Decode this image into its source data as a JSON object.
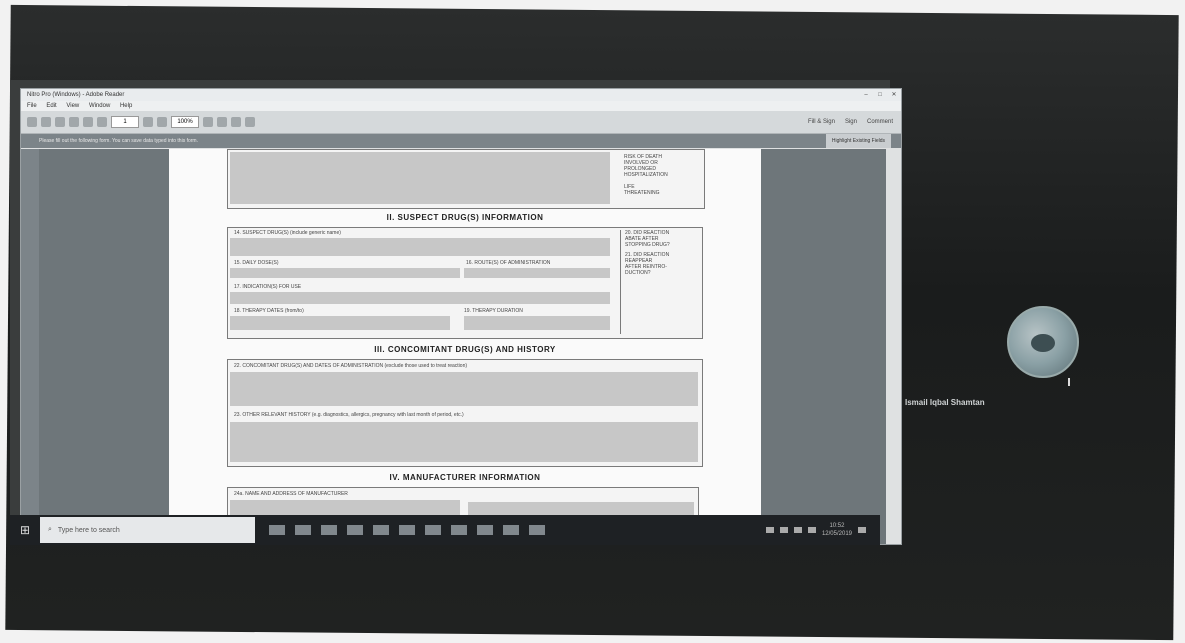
{
  "window": {
    "title": "Nitro Pro (Windows) - Adobe Reader",
    "menu": [
      "File",
      "Edit",
      "View",
      "Window",
      "Help"
    ],
    "zoom": "100%",
    "page_field": "1",
    "tools": [
      "Fill & Sign",
      "Sign",
      "Comment"
    ],
    "notice": "Please fill out the following form. You can save data typed into this form.",
    "highlight_button": "Highlight Existing Fields"
  },
  "form": {
    "top_right_box": [
      "RISK OF DEATH",
      "INVOLVED OR",
      "PROLONGED",
      "HOSPITALIZATION",
      "LIFE",
      "THREATENING"
    ],
    "section2_title": "II. SUSPECT DRUG(S) INFORMATION",
    "f14": "14. SUSPECT DRUG(S) (include generic name)",
    "f15": "15. DAILY DOSE(S)",
    "f16": "16. ROUTE(S) OF ADMINISTRATION",
    "f17": "17. INDICATION(S) FOR USE",
    "f18": "18. THERAPY DATES (from/to)",
    "f19": "19. THERAPY DURATION",
    "right_notes": [
      "20. DID REACTION",
      "ABATE AFTER",
      "STOPPING DRUG?",
      "21. DID REACTION",
      "REAPPEAR",
      "AFTER REINTRO-",
      "DUCTION?"
    ],
    "section3_title": "III. CONCOMITANT DRUG(S) AND HISTORY",
    "f22": "22. CONCOMITANT DRUG(S) AND DATES OF ADMINISTRATION (exclude those used to treat reaction)",
    "f23": "23. OTHER RELEVANT HISTORY (e.g. diagnostics, allergics, pregnancy with last month of period, etc.)",
    "section4_title": "IV. MANUFACTURER INFORMATION",
    "f24a": "24a. NAME AND ADDRESS OF MANUFACTURER"
  },
  "taskbar": {
    "search_placeholder": "Type here to search",
    "time": "10:52",
    "date": "12/05/2019"
  },
  "participant": {
    "name": "Ismail Iqbal Shamtan"
  }
}
